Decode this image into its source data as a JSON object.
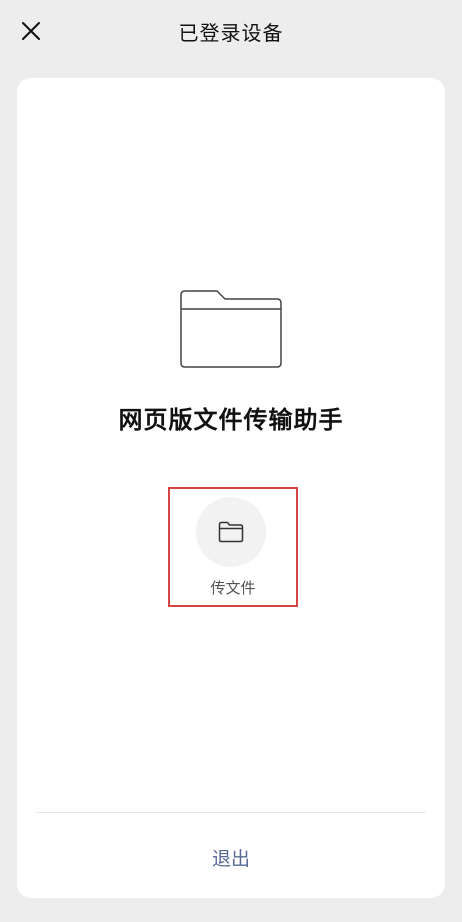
{
  "header": {
    "title": "已登录设备",
    "close_icon": "close-icon"
  },
  "device": {
    "icon": "folder-icon",
    "name": "网页版文件传输助手"
  },
  "actions": {
    "send_file_label": "传文件",
    "send_file_icon": "folder-icon",
    "highlight_color": "#d64545"
  },
  "footer": {
    "logout_label": "退出",
    "logout_color": "#576b95"
  }
}
